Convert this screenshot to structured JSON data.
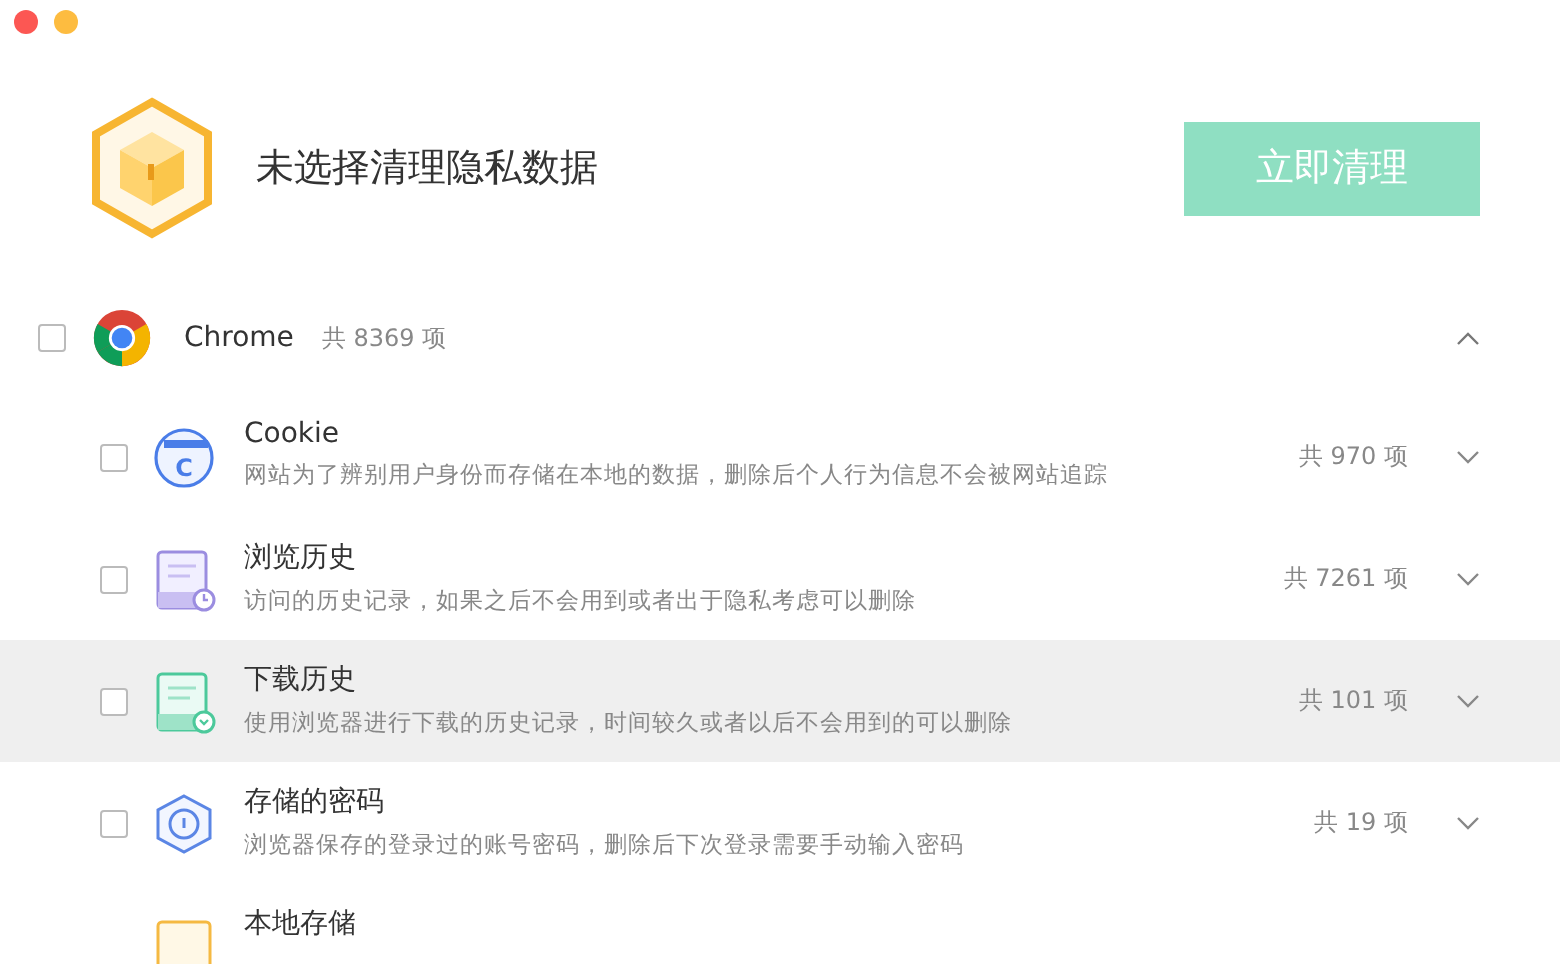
{
  "header": {
    "title": "未选择清理隐私数据",
    "clean_button": {
      "label": "立即清理",
      "disabled": true
    }
  },
  "browser": {
    "name": "Chrome",
    "count": "共 8369 项",
    "checked": false,
    "expanded": true,
    "items": [
      {
        "kind": "cookie",
        "icon_text": "C",
        "title": "Cookie",
        "description": "网站为了辨别用户身份而存储在本地的数据，删除后个人行为信息不会被网站追踪",
        "count": "共 970 项",
        "checked": false,
        "expanded": false,
        "selected": false
      },
      {
        "kind": "history",
        "title": "浏览历史",
        "description": "访问的历史记录，如果之后不会用到或者出于隐私考虑可以删除",
        "count": "共 7261 项",
        "checked": false,
        "expanded": false,
        "selected": false
      },
      {
        "kind": "download",
        "title": "下载历史",
        "description": "使用浏览器进行下载的历史记录，时间较久或者以后不会用到的可以删除",
        "count": "共 101 项",
        "checked": false,
        "expanded": false,
        "selected": true
      },
      {
        "kind": "password",
        "title": "存储的密码",
        "description": "浏览器保存的登录过的账号密码，删除后下次登录需要手动输入密码",
        "count": "共 19 项",
        "checked": false,
        "expanded": false,
        "selected": false
      },
      {
        "kind": "storage",
        "title": "本地存储",
        "selected": false
      }
    ]
  }
}
